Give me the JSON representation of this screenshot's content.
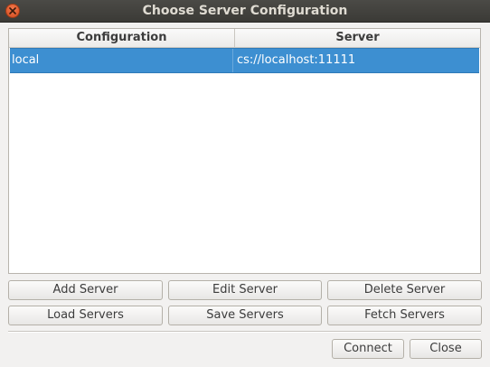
{
  "window": {
    "title": "Choose Server Configuration"
  },
  "table": {
    "columns": [
      "Configuration",
      "Server"
    ],
    "rows": [
      {
        "configuration": "local",
        "server": "cs://localhost:11111",
        "selected": true
      }
    ],
    "selection_color": "#3d8fd1"
  },
  "buttons": {
    "add_server": "Add Server",
    "edit_server": "Edit Server",
    "delete_server": "Delete Server",
    "load_servers": "Load Servers",
    "save_servers": "Save Servers",
    "fetch_servers": "Fetch Servers",
    "connect": "Connect",
    "close": "Close"
  },
  "icons": {
    "titlebar_close": "close-icon"
  },
  "colors": {
    "titlebar": "#3c3b37",
    "close_button": "#e5572c"
  }
}
